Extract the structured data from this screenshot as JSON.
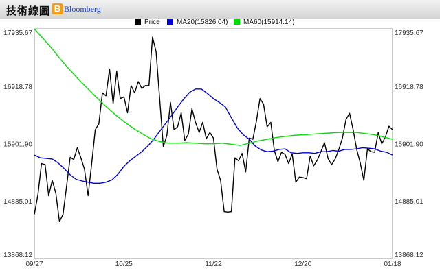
{
  "header": {
    "title": "技術線圖",
    "brand_letter": "B",
    "brand_name": "Bloomberg"
  },
  "chart_data": {
    "type": "line",
    "title": "",
    "xlabel": "",
    "ylabel": "",
    "ylim": [
      13868.12,
      17935.67
    ],
    "y_ticks": [
      "17935.67",
      "16918.78",
      "15901.90",
      "14885.01",
      "13868.12"
    ],
    "x_ticks": [
      "09/27",
      "10/25",
      "11/22",
      "12/20",
      "01/18"
    ],
    "grid": true,
    "legend_position": "top",
    "series": [
      {
        "name": "Price",
        "color": "#000000",
        "values": [
          14650,
          15000,
          15550,
          15530,
          14980,
          15250,
          15020,
          14520,
          14650,
          15150,
          15660,
          15620,
          15830,
          15650,
          15450,
          14980,
          15550,
          16150,
          16250,
          16800,
          16750,
          17220,
          16610,
          17180,
          16700,
          16730,
          16450,
          16930,
          16800,
          17000,
          16880,
          16930,
          16930,
          17790,
          17530,
          16690,
          15850,
          16050,
          16630,
          16150,
          16200,
          16450,
          15960,
          16070,
          16520,
          16280,
          16100,
          16280,
          15990,
          16100,
          16000,
          15450,
          15250,
          14700,
          14690,
          14700,
          15650,
          15600,
          15730,
          15400,
          16000,
          15980,
          16300,
          16700,
          16600,
          16200,
          16280,
          15780,
          15580,
          15750,
          15710,
          15550,
          15720,
          15220,
          15310,
          15300,
          15280,
          15680,
          15510,
          15610,
          15760,
          15920,
          15640,
          15530,
          15630,
          15800,
          16000,
          16330,
          16440,
          16150,
          15800,
          15560,
          15250,
          15810,
          15760,
          15750,
          16100,
          15900,
          16020,
          16210,
          16150
        ]
      },
      {
        "name": "MA20(15826.04)",
        "color": "#0000dd",
        "values": [
          15700,
          15650,
          15640,
          15630,
          15560,
          15460,
          15350,
          15270,
          15240,
          15220,
          15200,
          15200,
          15220,
          15260,
          15360,
          15500,
          15600,
          15680,
          15760,
          15860,
          15980,
          16120,
          16260,
          16400,
          16550,
          16690,
          16810,
          16870,
          16870,
          16790,
          16700,
          16630,
          16550,
          16360,
          16180,
          16060,
          15980,
          15860,
          15790,
          15760,
          15770,
          15800,
          15810,
          15740,
          15730,
          15740,
          15740,
          15730,
          15760,
          15760,
          15780,
          15770,
          15800,
          15800,
          15810,
          15830,
          15820,
          15810,
          15770,
          15750,
          15700
        ]
      },
      {
        "name": "MA60(15914.14)",
        "color": "#00e000",
        "values": [
          17935,
          17760,
          17580,
          17380,
          17200,
          17030,
          16870,
          16710,
          16560,
          16420,
          16290,
          16180,
          16080,
          15990,
          15940,
          15910,
          15910,
          15920,
          15910,
          15900,
          15900,
          15910,
          15890,
          15870,
          15910,
          15950,
          15980,
          16010,
          16030,
          16050,
          16060,
          16070,
          16080,
          16090,
          16100,
          16100,
          16100,
          16080,
          16060,
          16020,
          15980
        ]
      }
    ]
  }
}
